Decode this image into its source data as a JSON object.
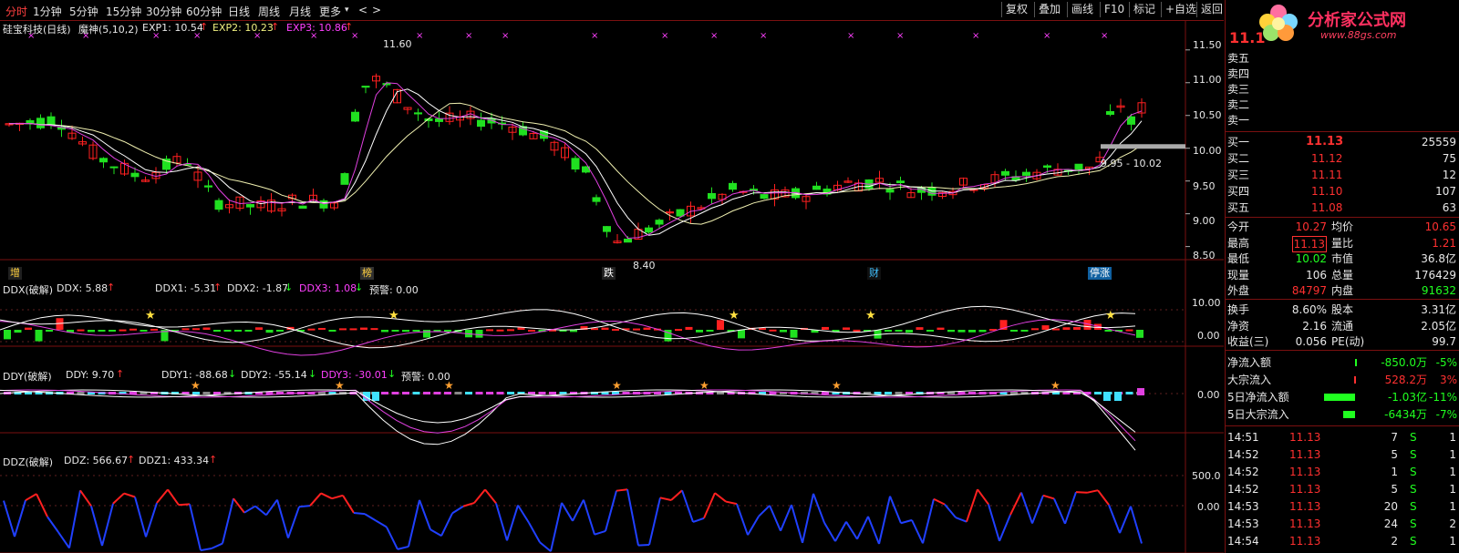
{
  "toolbar": {
    "periods": [
      "分时",
      "1分钟",
      "5分钟",
      "15分钟",
      "30分钟",
      "60分钟",
      "日线",
      "周线",
      "月线",
      "更多"
    ],
    "more_arrow": "▾",
    "back_arrow": "<",
    "fwd_arrow": ">",
    "buttons": [
      "复权",
      "叠加",
      "画线",
      "F10",
      "标记",
      "+自选",
      "返回"
    ]
  },
  "main_header": {
    "stock": "硅宝科技(日线)",
    "indicator": "魔神(5,10,2)",
    "exp1": "EXP1: 10.54",
    "exp2": "EXP2: 10.23",
    "exp3": "EXP3: 10.86",
    "up_arrow": "↑"
  },
  "price_axis": [
    "11.50",
    "11.00",
    "10.50",
    "10.00",
    "9.50",
    "9.00",
    "8.50"
  ],
  "annotations": {
    "high": "11.60",
    "low": "8.40",
    "range": "9.95 - 10.02"
  },
  "events": [
    {
      "label": "增",
      "color": "#ffd040",
      "bg": "#202020"
    },
    {
      "label": "榜",
      "color": "#ffd040",
      "bg": "#303030"
    },
    {
      "label": "跌",
      "color": "#ffffff",
      "bg": "#202020"
    },
    {
      "label": "财",
      "color": "#40c0ff",
      "bg": "#101010"
    },
    {
      "label": "停涨",
      "color": "#ffffff",
      "bg": "#1060a0"
    }
  ],
  "ddx": {
    "name": "DDX(破解)",
    "ddx": "DDX: 5.88",
    "ddx1": "DDX1: -5.31",
    "ddx2": "DDX2: -1.87",
    "ddx3": "DDX3: 1.08",
    "warn": "预警: 0.00",
    "axis": [
      "10.00",
      "0.00"
    ]
  },
  "ddy": {
    "name": "DDY(破解)",
    "ddy": "DDY: 9.70",
    "ddy1": "DDY1: -88.68",
    "ddy2": "DDY2: -55.14",
    "ddy3": "DDY3: -30.01",
    "warn": "预警: 0.00",
    "axis": [
      "0.00"
    ]
  },
  "ddz": {
    "name": "DDZ(破解)",
    "ddz": "DDZ: 566.67",
    "ddz1": "DDZ1: 433.34",
    "axis": [
      "500.0",
      "0.00"
    ]
  },
  "arrows": {
    "up": "↑",
    "down": "↓"
  },
  "panel": {
    "logo_text": "分析家公式网",
    "logo_url": "www.88gs.com",
    "price": "11.1",
    "sell": [
      "卖五",
      "卖四",
      "卖三",
      "卖二",
      "卖一"
    ],
    "buy": [
      {
        "label": "买一",
        "price": "11.13",
        "vol": "25559"
      },
      {
        "label": "买二",
        "price": "11.12",
        "vol": "75"
      },
      {
        "label": "买三",
        "price": "11.11",
        "vol": "12"
      },
      {
        "label": "买四",
        "price": "11.10",
        "vol": "107"
      },
      {
        "label": "买五",
        "price": "11.08",
        "vol": "63"
      }
    ],
    "stats": [
      {
        "l1": "今开",
        "v1": "10.27",
        "c1": "#ff3030",
        "l2": "均价",
        "v2": "10.65",
        "c2": "#ff3030"
      },
      {
        "l1": "最高",
        "v1": "11.13",
        "c1": "#ff3030",
        "l2": "量比",
        "v2": "1.21",
        "c2": "#ff3030"
      },
      {
        "l1": "最低",
        "v1": "10.02",
        "c1": "#20ff20",
        "l2": "市值",
        "v2": "36.8亿",
        "c2": "#e8e8e8"
      },
      {
        "l1": "现量",
        "v1": "106",
        "c1": "#e8e8e8",
        "l2": "总量",
        "v2": "176429",
        "c2": "#e8e8e8"
      },
      {
        "l1": "外盘",
        "v1": "84797",
        "c1": "#ff3030",
        "l2": "内盘",
        "v2": "91632",
        "c2": "#20ff20"
      }
    ],
    "stats2": [
      {
        "l1": "换手",
        "v1": "8.60%",
        "l2": "股本",
        "v2": "3.31亿"
      },
      {
        "l1": "净资",
        "v1": "2.16",
        "l2": "流通",
        "v2": "2.05亿"
      },
      {
        "l1": "收益(三)",
        "v1": "0.056",
        "l2": "PE(动)",
        "v2": "99.7"
      }
    ],
    "flows": [
      {
        "label": "净流入额",
        "val": "-850.0万",
        "pct": "-5%",
        "color": "#20ff20",
        "bar": 0
      },
      {
        "label": "大宗流入",
        "val": "528.2万",
        "pct": "3%",
        "color": "#ff3030",
        "bar": 0.03
      },
      {
        "label": "5日净流入额",
        "val": "-1.03亿",
        "pct": "-11%",
        "color": "#20ff20",
        "bar": 0.9
      },
      {
        "label": "5日大宗流入",
        "val": "-6434万",
        "pct": "-7%",
        "color": "#20ff20",
        "bar": 0.35
      }
    ],
    "ticks": [
      {
        "time": "14:51",
        "price": "11.13",
        "vol": "7",
        "side": "S",
        "n": "1"
      },
      {
        "time": "14:52",
        "price": "11.13",
        "vol": "5",
        "side": "S",
        "n": "1"
      },
      {
        "time": "14:52",
        "price": "11.13",
        "vol": "1",
        "side": "S",
        "n": "1"
      },
      {
        "time": "14:52",
        "price": "11.13",
        "vol": "5",
        "side": "S",
        "n": "1"
      },
      {
        "time": "14:53",
        "price": "11.13",
        "vol": "20",
        "side": "S",
        "n": "1"
      },
      {
        "time": "14:53",
        "price": "11.13",
        "vol": "24",
        "side": "S",
        "n": "2"
      },
      {
        "time": "14:54",
        "price": "11.13",
        "vol": "2",
        "side": "S",
        "n": "1"
      }
    ]
  },
  "colors": {
    "up": "#ff2020",
    "down": "#20e020",
    "grid": "#7a1010"
  }
}
